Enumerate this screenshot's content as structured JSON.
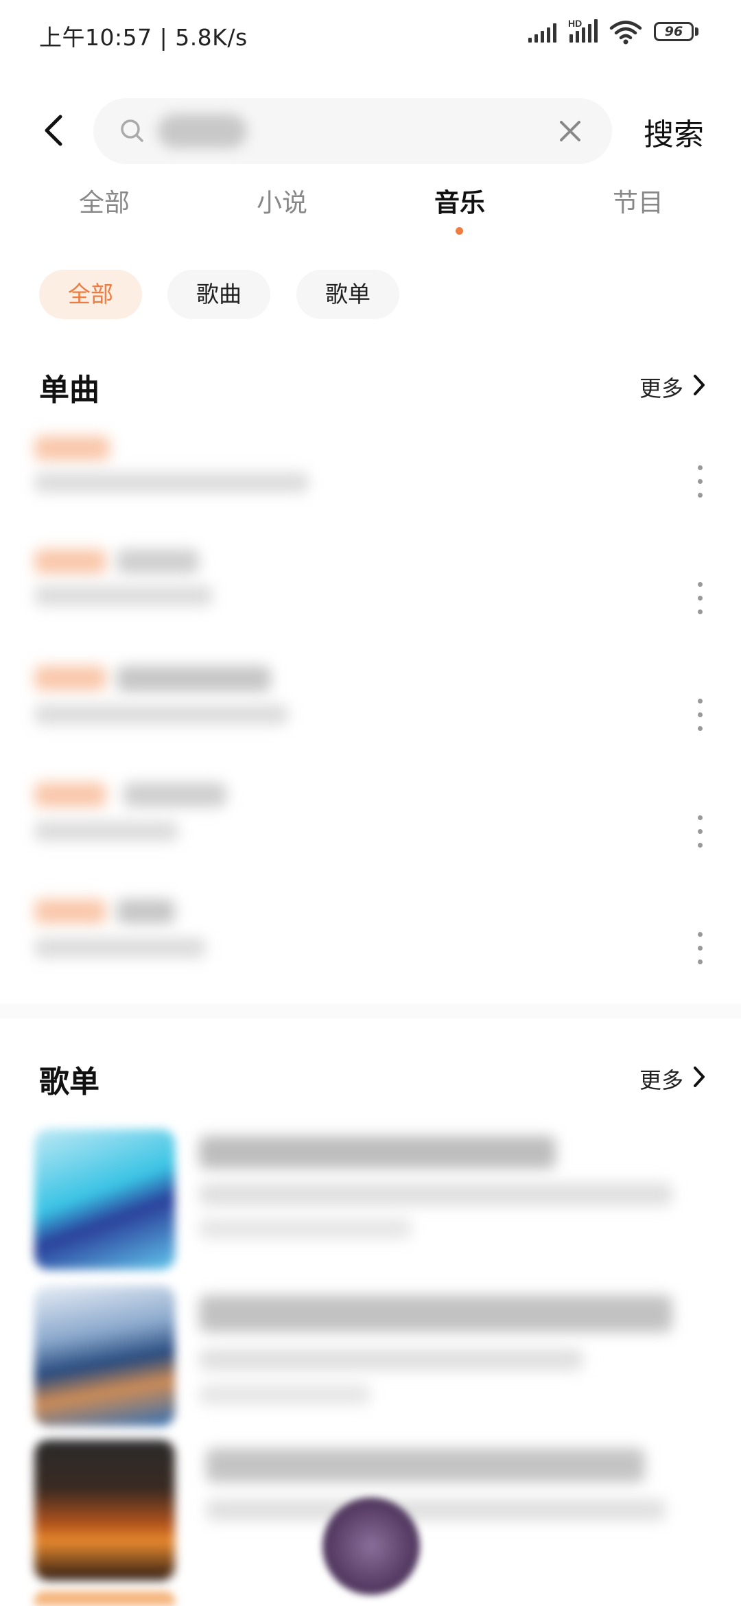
{
  "status_bar": {
    "time": "上午10:57 | 5.8K/s",
    "hd_label": "HD",
    "battery": "96"
  },
  "header": {
    "search_placeholder": "",
    "search_button": "搜索"
  },
  "tabs": [
    {
      "label": "全部",
      "active": false
    },
    {
      "label": "小说",
      "active": false
    },
    {
      "label": "音乐",
      "active": true
    },
    {
      "label": "节目",
      "active": false
    }
  ],
  "chips": [
    {
      "label": "全部",
      "active": true
    },
    {
      "label": "歌曲",
      "active": false
    },
    {
      "label": "歌单",
      "active": false
    }
  ],
  "songs_section": {
    "title": "单曲",
    "more": "更多"
  },
  "playlists_section": {
    "title": "歌单",
    "more": "更多"
  },
  "colors": {
    "accent": "#ee7b3f",
    "chip_active_bg": "#fdeee4",
    "text_primary": "#111111",
    "text_secondary": "#888888"
  }
}
